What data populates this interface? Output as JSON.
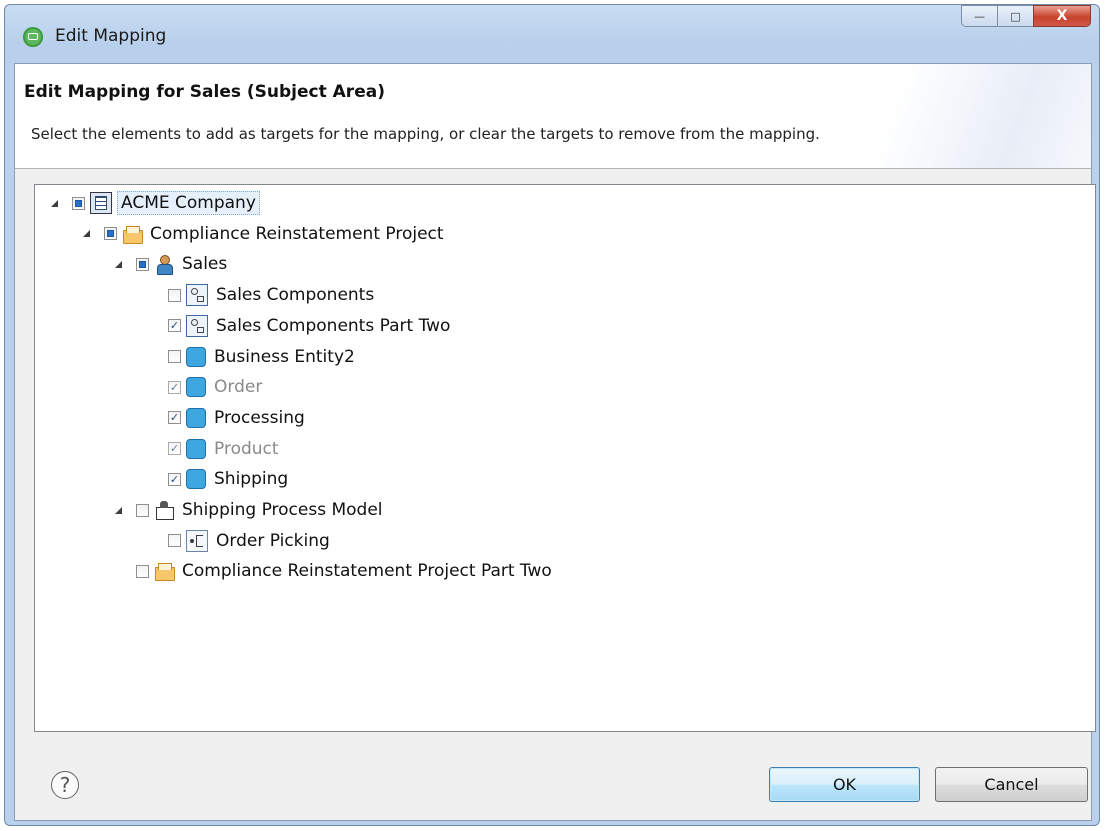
{
  "window": {
    "title": "Edit Mapping",
    "minimize_glyph": "—",
    "maximize_glyph": "□",
    "close_glyph": "X"
  },
  "header": {
    "title": "Edit Mapping for Sales (Subject Area)",
    "description": "Select the elements to add as targets for the mapping, or clear the targets to remove from the mapping."
  },
  "tree": {
    "items": [
      {
        "label": "ACME Company",
        "level": 0,
        "expanded": true,
        "check": "partial",
        "icon": "company-icon",
        "state": "selected"
      },
      {
        "label": "Compliance Reinstatement Project",
        "level": 1,
        "expanded": true,
        "check": "partial",
        "icon": "folder-icon",
        "state": "normal"
      },
      {
        "label": "Sales",
        "level": 2,
        "expanded": true,
        "check": "partial",
        "icon": "subject-area-icon",
        "state": "normal"
      },
      {
        "label": "Sales Components",
        "level": 3,
        "check": "unchecked",
        "icon": "component-model-icon",
        "state": "normal"
      },
      {
        "label": "Sales Components Part Two",
        "level": 3,
        "check": "checked",
        "icon": "component-model-icon",
        "state": "normal"
      },
      {
        "label": "Business Entity2",
        "level": 3,
        "check": "unchecked",
        "icon": "business-entity-icon",
        "state": "normal"
      },
      {
        "label": "Order",
        "level": 3,
        "check": "checked",
        "icon": "business-entity-icon",
        "state": "disabled"
      },
      {
        "label": "Processing",
        "level": 3,
        "check": "checked",
        "icon": "business-entity-icon",
        "state": "normal"
      },
      {
        "label": "Product",
        "level": 3,
        "check": "checked",
        "icon": "business-entity-icon",
        "state": "disabled"
      },
      {
        "label": "Shipping",
        "level": 3,
        "check": "checked",
        "icon": "business-entity-icon",
        "state": "normal"
      },
      {
        "label": "Shipping Process Model",
        "level": 2,
        "expanded": true,
        "check": "unchecked",
        "icon": "process-model-icon",
        "state": "normal"
      },
      {
        "label": "Order Picking",
        "level": 3,
        "check": "unchecked",
        "icon": "process-icon",
        "state": "normal"
      },
      {
        "label": "Compliance Reinstatement Project Part Two",
        "level": 2,
        "check": "unchecked",
        "icon": "folder-icon",
        "state": "normal"
      }
    ]
  },
  "footer": {
    "help_glyph": "?",
    "ok_label": "OK",
    "cancel_label": "Cancel"
  }
}
